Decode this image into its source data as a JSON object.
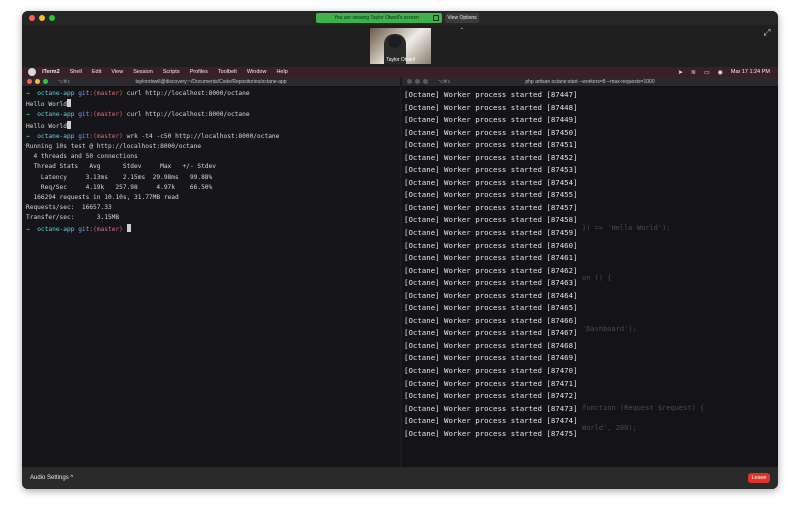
{
  "zoom": {
    "banner_text": "You are viewing Taylor Otwell's screen",
    "view_options": "View Options ⌄",
    "participant_name": "Taylor Otwell",
    "audio_settings": "Audio Settings",
    "audio_caret": "^",
    "leave_label": "Leave"
  },
  "menubar": {
    "items": [
      "iTerm2",
      "Shell",
      "Edit",
      "View",
      "Session",
      "Scripts",
      "Profiles",
      "Toolbelt",
      "Window",
      "Help"
    ],
    "clock": "Mar 17 1:24 PM"
  },
  "term_left": {
    "shortcut": "⌥⌘1",
    "path": "taylorotwell@discovery:~/Documents/Code/Repositories/octane-app",
    "prompt_dir": "octane-app",
    "git_label": "git:",
    "branch": "(master)",
    "cmd1": "curl http://localhost:8000/octane",
    "out1": "Hello World",
    "cmd2": "curl http://localhost:8000/octane",
    "out2": "Hello World",
    "cmd3": "wrk -t4 -c50 http://localhost:8000/octane",
    "wrk_lines": [
      "Running 10s test @ http://localhost:8000/octane",
      "  4 threads and 50 connections",
      "  Thread Stats   Avg      Stdev     Max   +/- Stdev",
      "    Latency     3.13ms    2.15ms  29.98ms   99.88%",
      "    Req/Sec     4.19k   257.98     4.97k    66.50%",
      "  166294 requests in 10.10s, 31.77MB read",
      "Requests/sec:  16657.33",
      "Transfer/sec:      3.15MB"
    ]
  },
  "term_right": {
    "shortcut": "⌥⌘1",
    "path": "php artisan octane:start --workers=8 --max-requests=1000",
    "worker_lines": [
      "[Octane] Worker process started [87447]",
      "[Octane] Worker process started [87448]",
      "[Octane] Worker process started [87449]",
      "[Octane] Worker process started [87450]",
      "[Octane] Worker process started [87451]",
      "[Octane] Worker process started [87452]",
      "[Octane] Worker process started [87453]",
      "[Octane] Worker process started [87454]",
      "[Octane] Worker process started [87455]",
      "[Octane] Worker process started [87457]",
      "[Octane] Worker process started [87458]",
      "[Octane] Worker process started [87459]",
      "[Octane] Worker process started [87460]",
      "[Octane] Worker process started [87461]",
      "[Octane] Worker process started [87462]",
      "[Octane] Worker process started [87463]",
      "[Octane] Worker process started [87464]",
      "[Octane] Worker process started [87465]",
      "[Octane] Worker process started [87466]",
      "[Octane] Worker process started [87467]",
      "[Octane] Worker process started [87468]",
      "[Octane] Worker process started [87469]",
      "[Octane] Worker process started [87470]",
      "[Octane] Worker process started [87471]",
      "[Octane] Worker process started [87472]",
      "[Octane] Worker process started [87473]",
      "[Octane] Worker process started [87474]",
      "[Octane] Worker process started [87475]"
    ],
    "ghost_lines": [
      "}) => 'Hello World');",
      "on () {",
      "'Dashboard');",
      "function (Request $request) {",
      "World', 200);"
    ]
  }
}
